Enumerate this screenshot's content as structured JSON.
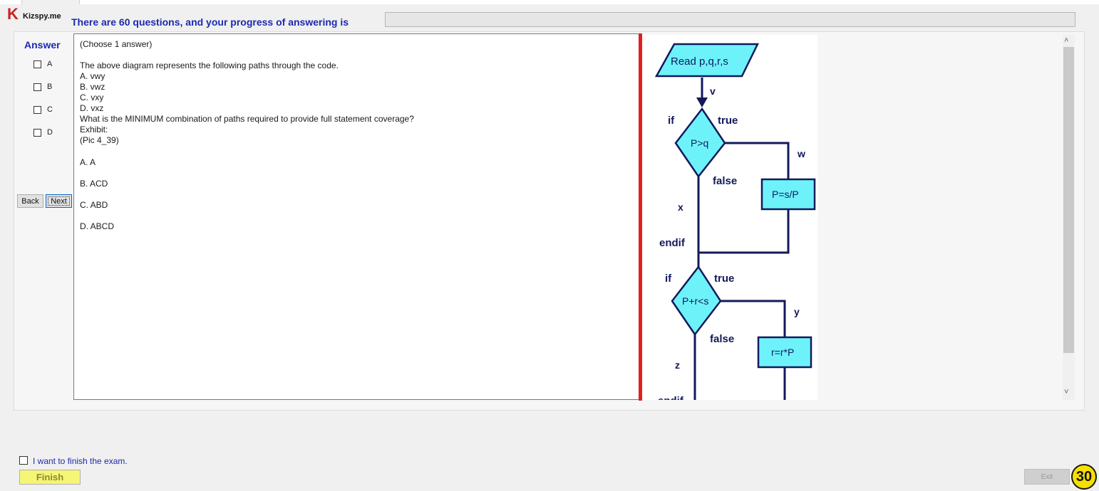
{
  "header": {
    "logo_text": "Kizspy.me",
    "progress_text": "There are 60 questions, and your progress of answering is"
  },
  "answer_panel": {
    "title": "Answer",
    "options": [
      "A",
      "B",
      "C",
      "D"
    ],
    "back_label": "Back",
    "next_label": "Next"
  },
  "question": {
    "instruction": "(Choose 1 answer)",
    "lines": [
      "The above diagram represents the following paths through the code.",
      "A. vwy",
      "B. vwz",
      "C. vxy",
      "D. vxz",
      "What is the MINIMUM combination of paths required to provide full statement coverage?",
      "Exhibit:",
      "(Pic 4_39)"
    ],
    "choices": [
      "A.  A",
      "B.  ACD",
      "C.  ABD",
      "D.  ABCD"
    ]
  },
  "diagram": {
    "read": "Read p,q,r,s",
    "v": "v",
    "if1": "if",
    "true1": "true",
    "cond1": "P>q",
    "w": "w",
    "false1": "false",
    "box1": "P=s/P",
    "x": "x",
    "endif1": "endif",
    "if2": "if",
    "true2": "true",
    "cond2": "P+r<s",
    "y": "y",
    "false2": "false",
    "box2": "r=r*P",
    "z": "z",
    "endif2": "endif",
    "colors": {
      "fill": "#6ef2fa",
      "line": "#121a5a"
    }
  },
  "footer": {
    "finish_check_label": "I want to finish the exam.",
    "finish_label": "Finish",
    "exit_label": "Exit",
    "badge": "30"
  }
}
